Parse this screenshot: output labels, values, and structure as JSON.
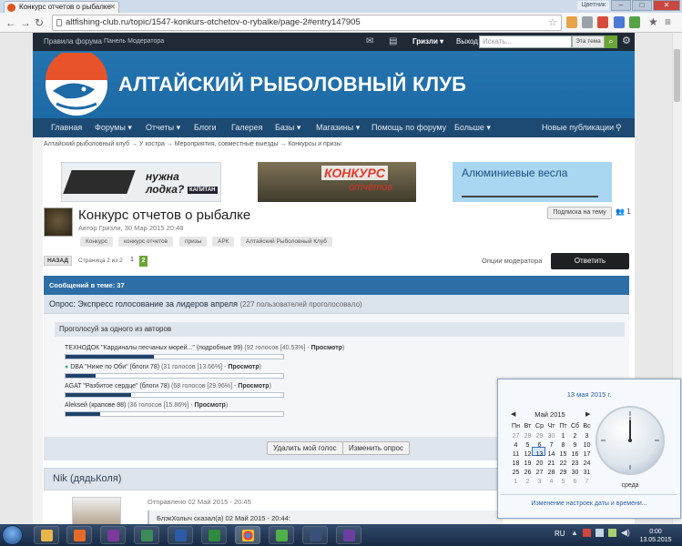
{
  "browser": {
    "tab_title": "Конкурс отчетов о рыбалке",
    "user_chip": "Цветник",
    "url": "altfishing-club.ru/topic/1547-konkurs-otchetov-o-rybalke/page-2#entry147905",
    "ext_badge": "+11"
  },
  "sitebar": {
    "rules": "Правила форума",
    "moderator_panel": "Панель Модератора",
    "user": "Гризли",
    "logout": "Выход",
    "search_placeholder": "Искать...",
    "search_scope": "Эта тема"
  },
  "header": {
    "site_title": "АЛТАЙСКИЙ РЫБОЛОВНЫЙ КЛУБ"
  },
  "nav": {
    "items": [
      "Главная",
      "Форумы",
      "Отчеты",
      "Блоги",
      "Галерея",
      "Базы",
      "Магазины",
      "Помощь по форуму",
      "Больше"
    ],
    "new_posts": "Новые публикации"
  },
  "breadcrumbs": [
    "Алтайский рыболовный клуб",
    "У костра",
    "Мероприятия, совместные выезды",
    "Конкурсы и призы"
  ],
  "ads": {
    "ad1_text": "нужна лодка?",
    "ad1_brand": "КАПИТАН",
    "ad2_text": "КОНКУРС",
    "ad2_sub": "отчётов",
    "ad3_text": "Алюминиевые весла"
  },
  "topic": {
    "title": "Конкурс отчетов о рыбалке",
    "meta": "Автор Гризли, 30 Мар 2015 20:48",
    "follow_label": "Подписка на тему",
    "follow_count": "1",
    "tags": [
      "Конкурс",
      "конкурс отчетов",
      "призы",
      "АРК",
      "Алтайский Рыболовный Клуб"
    ],
    "back": "НАЗАД",
    "page_label": "Страница 2 из 2",
    "page_1": "1",
    "page_2": "2",
    "mod_options": "Опции модератора",
    "reply": "Ответить",
    "post_count": "Сообщений в теме: 37"
  },
  "poll": {
    "title": "Опрос: Экспресс голосование за лидеров апреля",
    "voters": "(227 пользователей проголосовало)",
    "question": "Проголосуй за одного из авторов",
    "options": [
      {
        "label": "ТЕХНОДОК \"Кардиналы песчаных морей...\" (подробные 99)",
        "votes": "(92 голосов [40.53%] - ",
        "view": "Просмотр",
        "tail": ")",
        "percent": 40.53
      },
      {
        "label": "DBA \"Ниже по Оби\" (блоги 78)",
        "votes": "(31 голосов [13.66%] - ",
        "view": "Просмотр",
        "tail": ")",
        "percent": 13.66
      },
      {
        "label": "AGAT \"Разбитое сердце\" (блоги 78)",
        "votes": "(68 голосов [29.96%] - ",
        "view": "Просмотр",
        "tail": ")",
        "percent": 29.96
      },
      {
        "label": "Alekseй (крапове 88)",
        "votes": "(36 голосов [15.86%] - ",
        "view": "Просмотр",
        "tail": ")",
        "percent": 15.86
      }
    ],
    "delete_vote": "Удалить мой голос",
    "edit_poll": "Изменить опрос"
  },
  "post": {
    "author": "Nik (дядьКоля)",
    "time": "Отправлено 02 Май 2015 - 20:45",
    "quote": "БлэкХолыч сказал(а) 02 Май 2015 - 20:44:"
  },
  "calendar": {
    "date_link": "13 мая 2015 г.",
    "month": "Май 2015",
    "weekdays": [
      "Пн",
      "Вт",
      "Ср",
      "Чт",
      "Пт",
      "Сб",
      "Вс"
    ],
    "days": [
      [
        "27",
        "28",
        "29",
        "30",
        "1",
        "2",
        "3"
      ],
      [
        "4",
        "5",
        "6",
        "7",
        "8",
        "9",
        "10"
      ],
      [
        "11",
        "12",
        "13",
        "14",
        "15",
        "16",
        "17"
      ],
      [
        "18",
        "19",
        "20",
        "21",
        "22",
        "23",
        "24"
      ],
      [
        "25",
        "26",
        "27",
        "28",
        "29",
        "30",
        "31"
      ],
      [
        "1",
        "2",
        "3",
        "4",
        "5",
        "6",
        "7"
      ]
    ],
    "clock_day": "среда",
    "settings_link": "Изменение настроек даты и времени..."
  },
  "taskbar": {
    "lang": "RU",
    "time": "0:00",
    "date": "13.05.2015"
  },
  "colors": {
    "header": "#2474b0",
    "nav": "#1c4a72",
    "accent_green": "#6ba437",
    "poll_bar": "#20426a"
  }
}
